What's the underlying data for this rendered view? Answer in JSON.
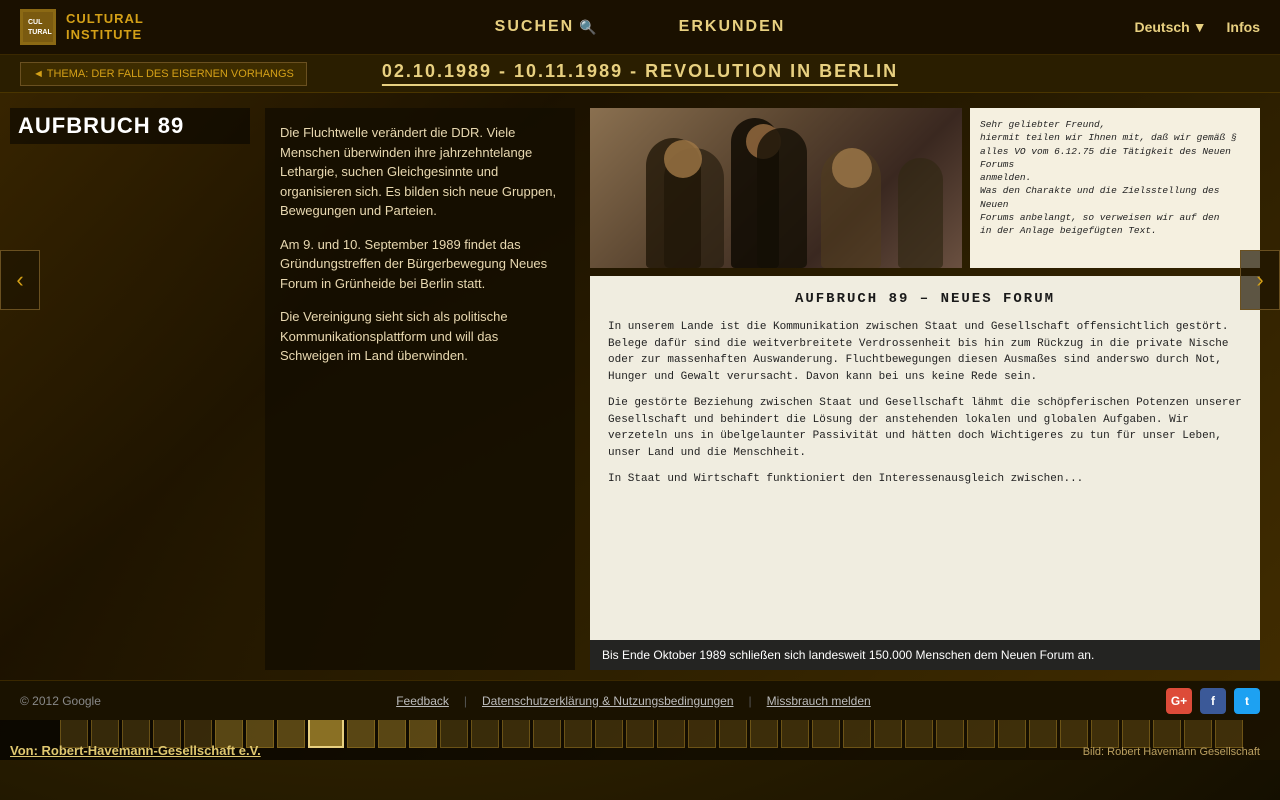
{
  "header": {
    "logo_line1": "CULTURAL",
    "logo_line2": "INSTITUTE",
    "nav_search": "SUCHEN",
    "nav_explore": "ERKUNDEN",
    "language": "Deutsch",
    "infos": "Infos"
  },
  "breadcrumb": {
    "back_label": "◄  THEMA: DER FALL DES EISERNEN VORHANGS",
    "page_title": "02.10.1989 - 10.11.1989 - REVOLUTION IN BERLIN"
  },
  "left_panel": {
    "title": "AUFBRUCH 89"
  },
  "center_text": {
    "para1": "Die Fluchtwelle verändert die DDR. Viele Menschen überwinden ihre jahrzehntelange Lethargie, suchen Gleichgesinnte und organisieren sich. Es bilden sich neue Gruppen, Bewegungen und Parteien.",
    "para2": "Am 9. und 10. September 1989 findet das Gründungstreffen der Bürgerbewegung Neues Forum in Grünheide bei Berlin statt.",
    "para3": "Die Vereinigung sieht sich als politische Kommunikationsplattform und will das Schweigen im Land überwinden."
  },
  "letter": {
    "text": "Sehr geliebter Freund,\nhiermit teilen wir Ihnen mit, daß wir gemäß §\nalles VO vom 6.12.75 die Tätigkeit des Neuen Forums\nanmelden.\nWas den Charakte und die Zielsstellung des Neuen\nForums anbelangt, so verweisen wir auf den\nin der Anlage beigefügten Text."
  },
  "document": {
    "title": "Aufbruch 89 – Neues Forum",
    "para1": "In unserem Lande ist die Kommunikation zwischen Staat und Gesellschaft offensichtlich gestört. Belege dafür sind die weitverbreitete Verdrossenheit bis hin zum Rückzug in die private Nische oder zur massenhaften Auswanderung. Fluchtbewegungen diesen Ausmaßes sind anderswo durch Not, Hunger und Gewalt verursacht. Davon kann bei uns keine Rede sein.",
    "para2": "Die gestörte Beziehung zwischen Staat und Gesellschaft lähmt die schöpferischen Potenzen unserer Gesellschaft und behindert die Lösung der anstehenden lokalen und globalen Aufgaben. Wir verzeteln uns in übelgelaunter Passivität und hätten doch Wichtigeres zu tun für unser Leben, unser Land und die Menschheit.",
    "para3": "In Staat und Wirtschaft funktioniert den Interessenausgleich zwischen...",
    "caption": "Bis Ende Oktober 1989 schließen sich landesweit 150.000 Menschen dem Neuen Forum an."
  },
  "source": {
    "von": "Von: Robert-Havemann-Gesellschaft e.V.",
    "bild": "Bild: Robert Havemann Gesellschaft"
  },
  "footer": {
    "copyright": "© 2012 Google",
    "feedback": "Feedback",
    "privacy": "Datenschutzerklärung & Nutzungsbedingungen",
    "abuse": "Missbrauch melden"
  },
  "timeline": {
    "items_count": 38,
    "active_index": 8
  }
}
